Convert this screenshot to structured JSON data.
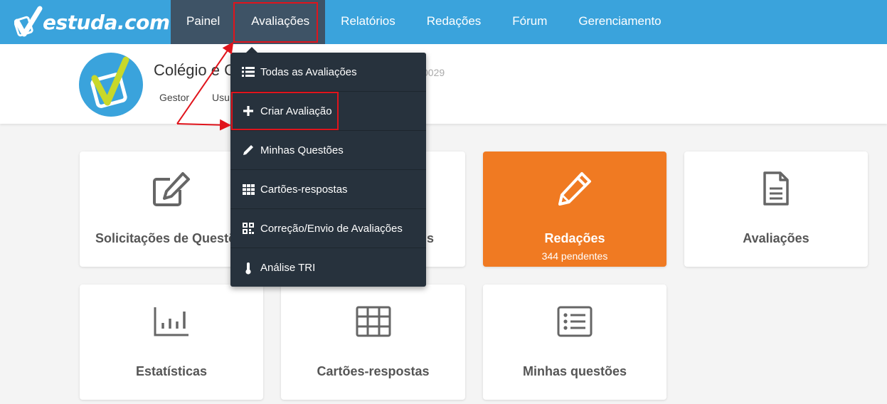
{
  "brand": {
    "name": "estuda.com"
  },
  "nav": {
    "items": [
      {
        "label": "Painel"
      },
      {
        "label": "Avaliações"
      },
      {
        "label": "Relatórios"
      },
      {
        "label": "Redações"
      },
      {
        "label": "Fórum"
      },
      {
        "label": "Gerenciamento"
      }
    ]
  },
  "header": {
    "school_name": "Colégio e C",
    "code_fragment": "0029",
    "tabs": [
      {
        "label": "Gestor"
      },
      {
        "label": "Usu"
      }
    ]
  },
  "cards": [
    {
      "label": "Solicitações de Questõ",
      "icon": "edit-icon"
    },
    {
      "label": "s",
      "icon": ""
    },
    {
      "label": "Redações",
      "sub": "344 pendentes",
      "icon": "pencil-icon",
      "color": "#f07a22"
    },
    {
      "label": "Avaliações",
      "icon": "document-icon"
    },
    {
      "label": "Estatísticas",
      "icon": "bar-chart-icon"
    },
    {
      "label": "Cartões-respostas",
      "icon": "grid-icon"
    },
    {
      "label": "Minhas questões",
      "icon": "list-icon"
    }
  ],
  "dropdown": {
    "items": [
      {
        "label": "Todas as Avaliações",
        "icon": "list-icon"
      },
      {
        "label": "Criar Avaliação",
        "icon": "plus-icon"
      },
      {
        "label": "Minhas Questões",
        "icon": "pencil-icon"
      },
      {
        "label": "Cartões-respostas",
        "icon": "grid-icon"
      },
      {
        "label": "Correção/Envio de Avaliações",
        "icon": "qrcode-icon"
      },
      {
        "label": "Análise TRI",
        "icon": "thermometer-icon"
      }
    ]
  },
  "colors": {
    "nav": "#3aa3dc",
    "nav_active": "#3e5366",
    "dropdown": "#27323d",
    "accent": "#f07a22",
    "highlight": "#e0141c"
  }
}
